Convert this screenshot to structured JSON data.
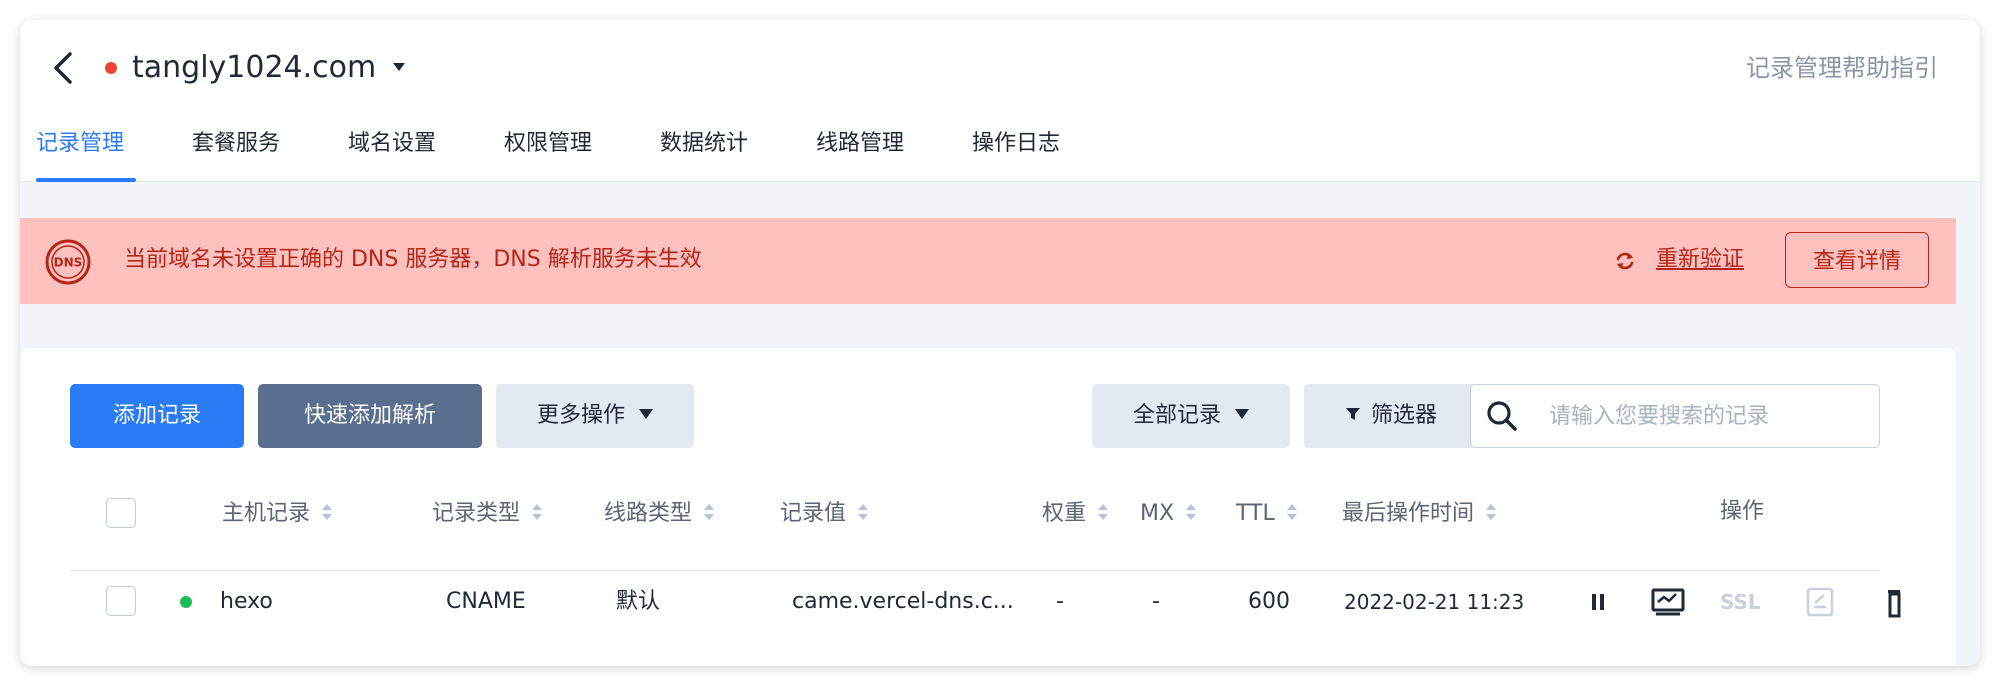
{
  "header": {
    "domain": "tangly1024.com",
    "help_link": "记录管理帮助指引"
  },
  "tabs": [
    {
      "label": "记录管理",
      "active": true
    },
    {
      "label": "套餐服务"
    },
    {
      "label": "域名设置"
    },
    {
      "label": "权限管理"
    },
    {
      "label": "数据统计"
    },
    {
      "label": "线路管理"
    },
    {
      "label": "操作日志"
    }
  ],
  "alert": {
    "message": "当前域名未设置正确的 DNS 服务器，DNS 解析服务未生效",
    "reverify_label": "重新验证",
    "detail_label": "查看详情",
    "icon_text": "DNS"
  },
  "toolbar": {
    "add_record": "添加记录",
    "quick_add": "快速添加解析",
    "more_actions": "更多操作",
    "all_records": "全部记录",
    "filter": "筛选器",
    "search_placeholder": "请输入您要搜索的记录"
  },
  "table": {
    "columns": {
      "host": "主机记录",
      "type": "记录类型",
      "line": "线路类型",
      "value": "记录值",
      "weight": "权重",
      "mx": "MX",
      "ttl": "TTL",
      "last_modified": "最后操作时间",
      "actions": "操作"
    },
    "rows": [
      {
        "status": "enabled",
        "host": "hexo",
        "type": "CNAME",
        "line": "默认",
        "value": "came.vercel-dns.c...",
        "weight": "-",
        "mx": "-",
        "ttl": "600",
        "last_modified": "2022-02-21 11:23",
        "ssl_label": "SSL"
      }
    ]
  },
  "colors": {
    "accent": "#2a7cf6",
    "alert_bg": "#ffc1bd",
    "alert_text": "#b4261b",
    "status_red": "#f04134",
    "status_green": "#1fba5a"
  }
}
